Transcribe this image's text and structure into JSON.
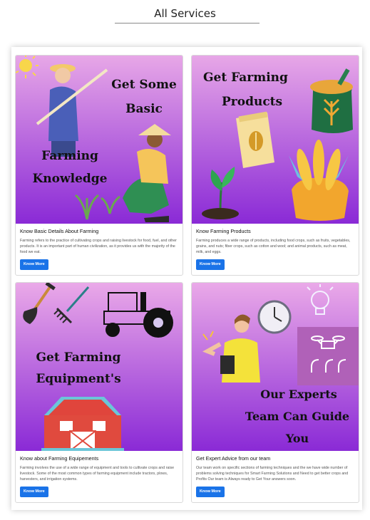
{
  "page": {
    "title": "All Services"
  },
  "colors": {
    "button": "#1a73e8",
    "banner_top": "#e8a6e6",
    "banner_bottom": "#8b2bd8"
  },
  "cards": [
    {
      "banner_lines": [
        "Get Some",
        "Basic",
        "Farming",
        "Knowledge"
      ],
      "title": "Know Basic Details About Farming",
      "text": "Farming refers to the practice of cultivating crops and raising livestock for food, fuel, and other products. It is an important part of human civilization, as it provides us with the majority of the food we eat.",
      "button": "Know More",
      "icons": [
        "sun-icon",
        "farmer-icon",
        "hoe-icon",
        "plant-icon"
      ]
    },
    {
      "banner_lines": [
        "Get Farming",
        "Products"
      ],
      "title": "Know Farming Products",
      "text": "Farming produces a wide range of products, including food crops, such as fruits, vegetables, grains, and nuts; fiber crops, such as cotton and wool; and animal products, such as meat, milk, and eggs.",
      "button": "Know More",
      "icons": [
        "seed-bag-icon",
        "grain-sack-icon",
        "corn-icon",
        "sprout-icon"
      ]
    },
    {
      "banner_lines": [
        "Get Farming",
        "Equipment's"
      ],
      "title": "Know about Farming Equipements",
      "text": "Farming involves the use of a wide range of equipment and tools to cultivate crops and raise livestock. Some of the most common types of farming equipment include tractors, plows, harvesters, and irrigation systems.",
      "button": "Know More",
      "icons": [
        "shovel-icon",
        "rake-icon",
        "tractor-icon",
        "barn-icon"
      ]
    },
    {
      "banner_lines": [
        "Our Experts",
        "Team Can Guide",
        "You"
      ],
      "title": "Get Expert Advice from our team",
      "text": "Our team work on specific sections of farming techniques and the we have wide number of problems solving techniques for Smart Farming Solutions and Need to get better crops and Profits Our team is Always ready to Get Your answers soon.",
      "button": "Know More",
      "icons": [
        "expert-icon",
        "clock-icon",
        "lightbulb-icon",
        "drone-icon"
      ]
    }
  ]
}
